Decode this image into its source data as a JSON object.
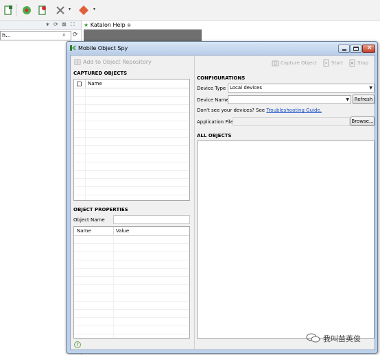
{
  "ide": {
    "search_placeholder": "h...",
    "tab_label": "Katalon Help",
    "tab_close": "⊗"
  },
  "dialog": {
    "title": "Mobile Object Spy",
    "left": {
      "add_to_repo": "Add to Object Repository",
      "captured_heading": "CAPTURED OBJECTS",
      "captured_columns": [
        "Name"
      ],
      "properties_heading": "OBJECT PROPERTIES",
      "object_name_label": "Object Name",
      "object_name_value": "",
      "properties_columns": [
        "Name",
        "Value"
      ],
      "help": "?"
    },
    "right": {
      "toolbar": {
        "capture": "Capture Object",
        "start": "Start",
        "stop": "Stop"
      },
      "config_heading": "CONFIGURATIONS",
      "device_type_label": "Device Type",
      "device_type_value": "Local devices",
      "device_name_label": "Device Name",
      "device_name_value": "",
      "refresh": "Refresh",
      "hint_text": "Don't see your devices? See ",
      "hint_link": "Troubleshooting Guide.",
      "app_file_label": "Application File",
      "app_file_value": "",
      "browse": "Browse...",
      "all_objects_heading": "ALL OBJECTS"
    }
  },
  "watermark": {
    "text": "我叫苗英俊"
  },
  "colors": {
    "title_gradient_top": "#d8e6f6",
    "close_red": "#c4402a",
    "link_blue": "#1a4fc7",
    "tab_star_green": "#3a9a3a"
  }
}
